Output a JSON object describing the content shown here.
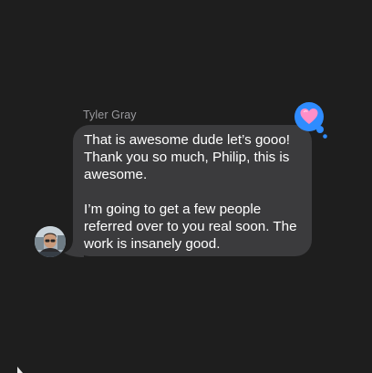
{
  "conversation": {
    "sender_name": "Tyler Gray",
    "message_paragraphs": [
      "That is awesome dude let’s gooo! Thank you so much, Philip, this is awesome.",
      "I’m going to get a few people referred over to you real soon. The work is insanely good."
    ],
    "reaction_icon": "heart-tapback-icon",
    "avatar_icon": "contact-photo-avatar"
  },
  "colors": {
    "background": "#1e1e1e",
    "bubble": "#3b3b3d",
    "sender_name": "#9a9a9e",
    "message_text": "#ffffff",
    "reaction_bubble": "#2f8cff",
    "heart": "#ff8fc8"
  }
}
